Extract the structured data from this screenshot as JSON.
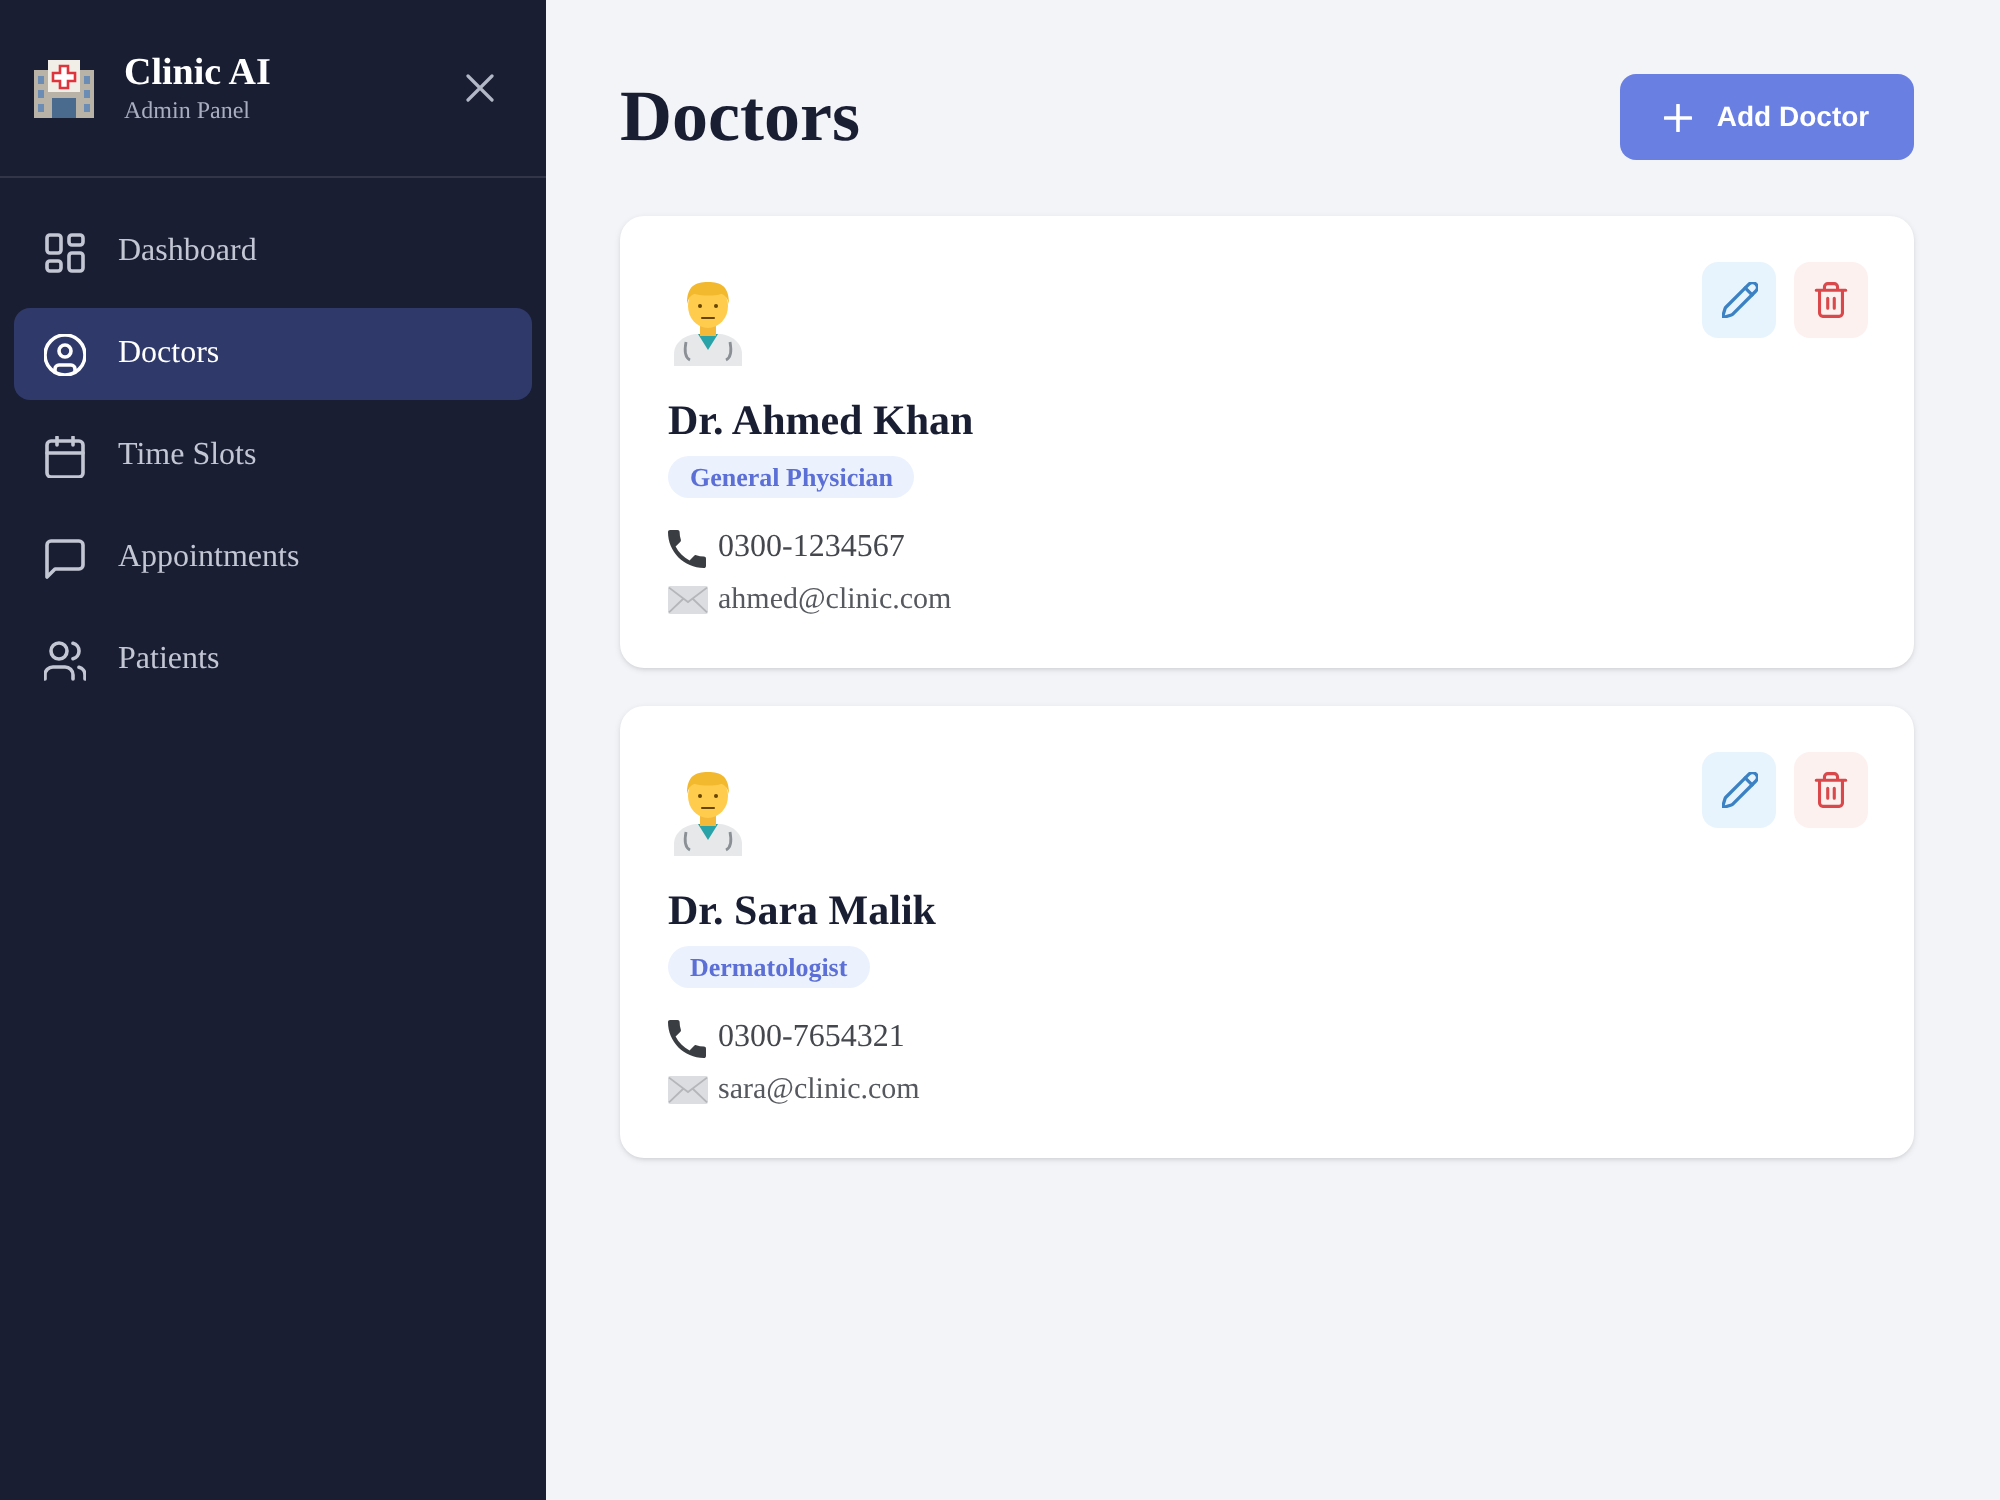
{
  "sidebar": {
    "brand": {
      "title": "Clinic AI",
      "subtitle": "Admin Panel"
    },
    "items": [
      {
        "label": "Dashboard",
        "kind": "dashboard",
        "selected": false
      },
      {
        "label": "Doctors",
        "kind": "doctors",
        "selected": true
      },
      {
        "label": "Time Slots",
        "kind": "calendar",
        "selected": false
      },
      {
        "label": "Appointments",
        "kind": "chat",
        "selected": false
      },
      {
        "label": "Patients",
        "kind": "people",
        "selected": false
      }
    ]
  },
  "page": {
    "title": "Doctors",
    "add_button": "Add Doctor"
  },
  "doctors": [
    {
      "name": "Dr. Ahmed Khan",
      "specialty": "General Physician",
      "phone": "0300-1234567",
      "email": "ahmed@clinic.com"
    },
    {
      "name": "Dr. Sara Malik",
      "specialty": "Dermatologist",
      "phone": "0300-7654321",
      "email": "sara@clinic.com"
    }
  ]
}
